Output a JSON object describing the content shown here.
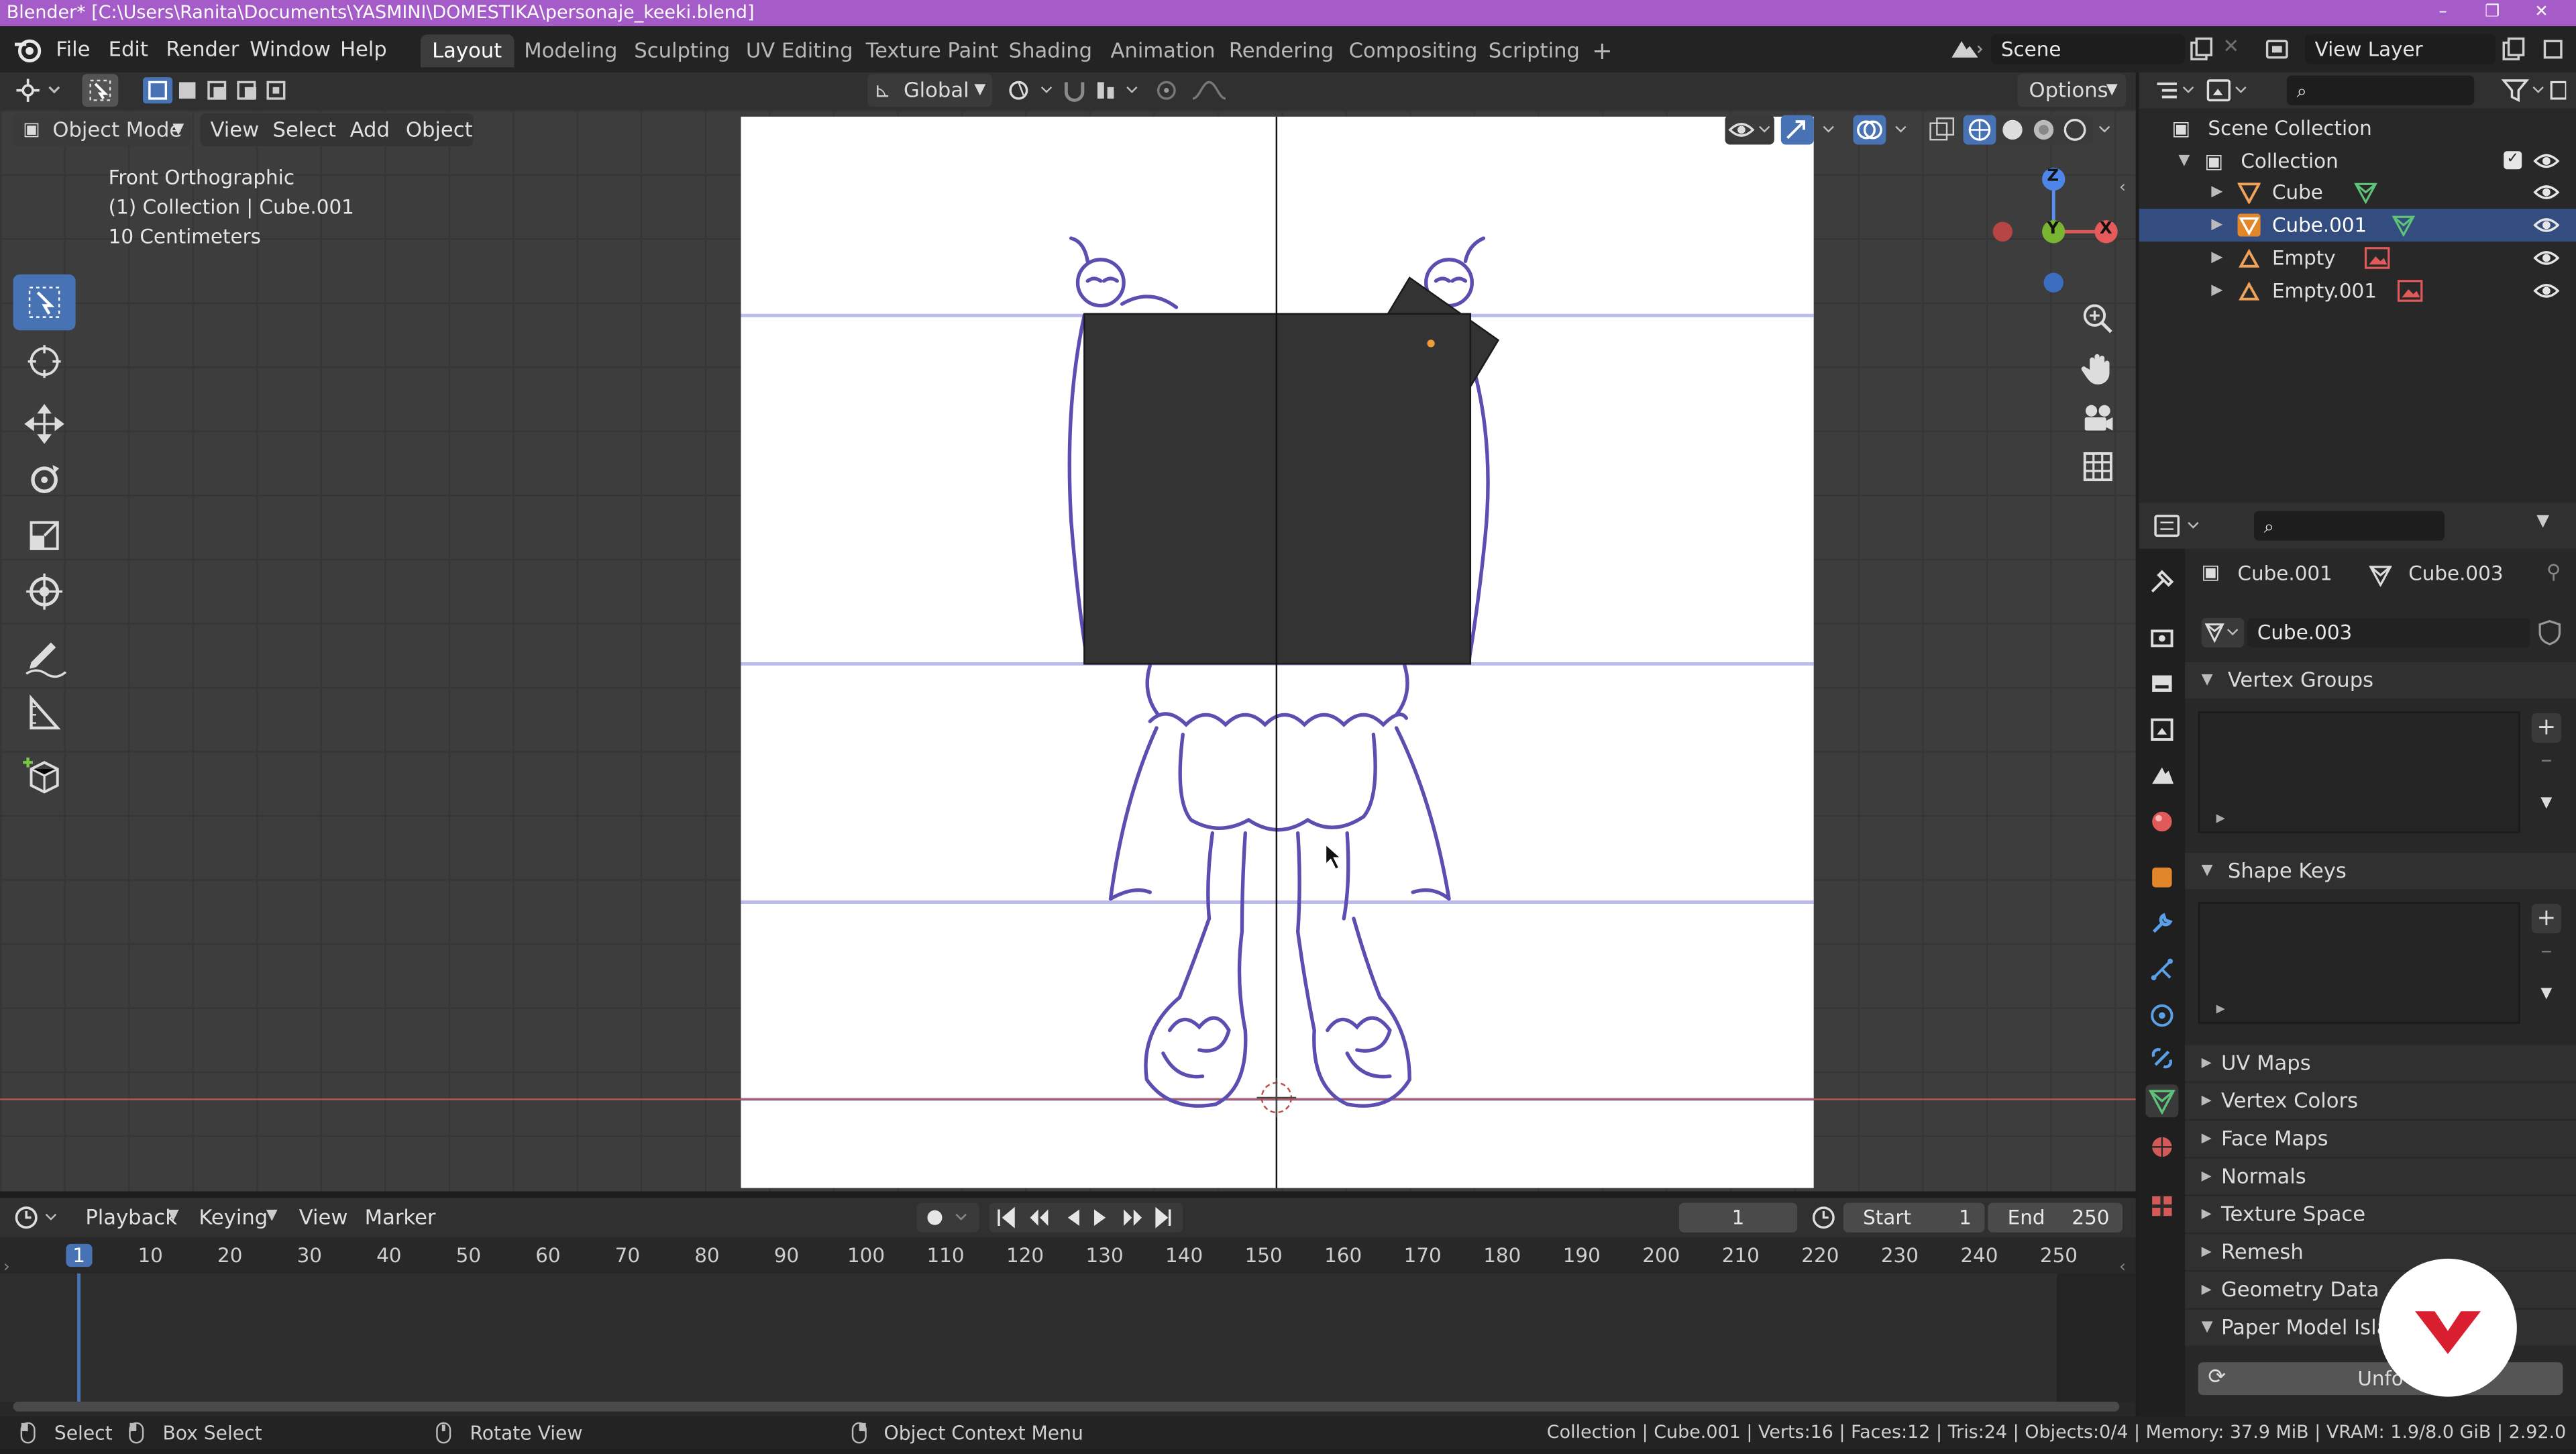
{
  "window": {
    "title": "Blender* [C:\\Users\\Ranita\\Documents\\YASMINI\\DOMESTIKA\\personaje_keeki.blend]",
    "controls": [
      "–",
      "❐",
      "✕"
    ]
  },
  "menu": [
    "File",
    "Edit",
    "Render",
    "Window",
    "Help"
  ],
  "workspace_tabs": [
    "Layout",
    "Modeling",
    "Sculpting",
    "UV Editing",
    "Texture Paint",
    "Shading",
    "Animation",
    "Rendering",
    "Compositing",
    "Scripting",
    "+"
  ],
  "active_tab": "Layout",
  "scene": {
    "name": "Scene",
    "view_layer": "View Layer"
  },
  "viewport_header": {
    "mode": "Object Mode",
    "menus": [
      "View",
      "Select",
      "Add",
      "Object"
    ],
    "orientation": "Global",
    "options": "Options"
  },
  "viewport_overlay_text": {
    "view": "Front Orthographic",
    "collection": "(1) Collection | Cube.001",
    "scale": "10 Centimeters"
  },
  "gizmo": {
    "z": "Z",
    "y": "Y",
    "x": "X"
  },
  "outliner": {
    "root": "Scene Collection",
    "collection": "Collection",
    "items": [
      {
        "name": "Cube",
        "type": "mesh"
      },
      {
        "name": "Cube.001",
        "type": "mesh"
      },
      {
        "name": "Empty",
        "type": "image-empty"
      },
      {
        "name": "Empty.001",
        "type": "image-empty"
      }
    ]
  },
  "properties": {
    "object": "Cube.001",
    "mesh": "Cube.003",
    "data_name": "Cube.003",
    "panels": [
      {
        "label": "Vertex Groups",
        "open": true
      },
      {
        "label": "Shape Keys",
        "open": true
      },
      {
        "label": "UV Maps",
        "open": false
      },
      {
        "label": "Vertex Colors",
        "open": false
      },
      {
        "label": "Face Maps",
        "open": false
      },
      {
        "label": "Normals",
        "open": false
      },
      {
        "label": "Texture Space",
        "open": false
      },
      {
        "label": "Remesh",
        "open": false
      },
      {
        "label": "Geometry Data",
        "open": false
      },
      {
        "label": "Paper Model Islan",
        "open": true
      }
    ],
    "unfold_button": "Unfo"
  },
  "timeline": {
    "menus": [
      "Playback",
      "Keying",
      "View",
      "Marker"
    ],
    "current_frame": "1",
    "start_label": "Start",
    "start_value": "1",
    "end_label": "End",
    "end_value": "250",
    "ruler": [
      "1",
      "10",
      "20",
      "30",
      "40",
      "50",
      "60",
      "70",
      "80",
      "90",
      "100",
      "110",
      "120",
      "130",
      "140",
      "150",
      "160",
      "170",
      "180",
      "190",
      "200",
      "210",
      "220",
      "230",
      "240",
      "250"
    ]
  },
  "statusbar": {
    "select": "Select",
    "box_select": "Box Select",
    "rotate_view": "Rotate View",
    "context_menu": "Object Context Menu",
    "stats": "Collection | Cube.001 | Verts:16 | Faces:12 | Tris:24 | Objects:0/4 | Memory: 37.9 MiB | VRAM: 1.9/8.0 GiB | 2.92.0"
  },
  "colors": {
    "title_bar": "#a55cc8",
    "active_blue": "#4772b3",
    "sketch_line": "#5a4fb0",
    "cube_fill": "#333333",
    "watermark": "#d91f2f"
  }
}
